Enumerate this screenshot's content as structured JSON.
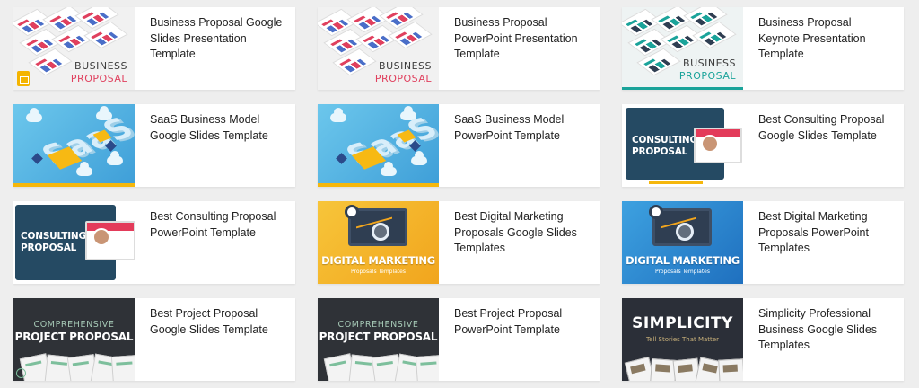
{
  "cards": [
    {
      "title": "Business Proposal Google Slides Presentation Template",
      "thumb": {
        "type": "business",
        "word1": "BUSINESS",
        "word2": "PROPOSAL",
        "accent": "#e0405e",
        "icon": "google-slides-icon"
      }
    },
    {
      "title": "Business Proposal PowerPoint Presentation Template",
      "thumb": {
        "type": "business",
        "word1": "BUSINESS",
        "word2": "PROPOSAL",
        "accent": "#e0405e"
      }
    },
    {
      "title": "Business Proposal Keynote Presentation Template",
      "thumb": {
        "type": "business",
        "word1": "BUSINESS",
        "word2": "PROPOSAL",
        "accent": "#1aa39a"
      }
    },
    {
      "title": "SaaS Business Model Google Slides Template",
      "thumb": {
        "type": "saas",
        "word": "SaaS"
      }
    },
    {
      "title": "SaaS Business Model PowerPoint Template",
      "thumb": {
        "type": "saas",
        "word": "SaaS"
      }
    },
    {
      "title": "Best Consulting Proposal Google Slides Template",
      "thumb": {
        "type": "consulting",
        "line1": "CONSULTING",
        "line2": "PROPOSAL"
      }
    },
    {
      "title": "Best Consulting Proposal PowerPoint Template",
      "thumb": {
        "type": "consulting",
        "line1": "CONSULTING",
        "line2": "PROPOSAL"
      }
    },
    {
      "title": "Best Digital Marketing Proposals Google Slides Templates",
      "thumb": {
        "type": "digital",
        "headline": "DIGITAL MARKETING",
        "sub": "Proposals Templates",
        "bg": "yellow"
      }
    },
    {
      "title": "Best Digital Marketing Proposals PowerPoint Templates",
      "thumb": {
        "type": "digital",
        "headline": "DIGITAL MARKETING",
        "sub": "Proposals Templates",
        "bg": "blue"
      }
    },
    {
      "title": "Best Project Proposal Google Slides Template",
      "thumb": {
        "type": "project",
        "line1": "COMPREHENSIVE",
        "line2": "PROJECT PROPOSAL"
      }
    },
    {
      "title": "Best Project Proposal PowerPoint Template",
      "thumb": {
        "type": "project",
        "line1": "COMPREHENSIVE",
        "line2": "PROJECT PROPOSAL"
      }
    },
    {
      "title": "Simplicity Professional Business Google Slides Templates",
      "thumb": {
        "type": "simplicity",
        "big": "SIMPLICITY",
        "small": "Tell Stories That Matter"
      }
    }
  ]
}
